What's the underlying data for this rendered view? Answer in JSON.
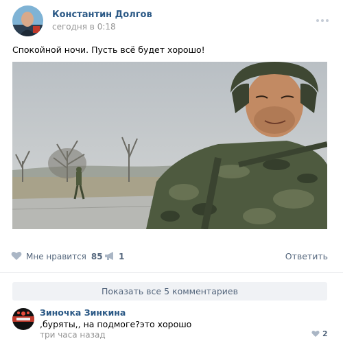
{
  "post": {
    "author": "Константин Долгов",
    "date": "сегодня в 0:18",
    "text": "Спокойной ночи. Пусть всё будет хорошо!",
    "actions": {
      "like_label": "Мне нравится",
      "like_count": "85",
      "share_count": "1",
      "reply_label": "Ответить"
    },
    "show_comments_label": "Показать все 5 комментариев"
  },
  "comment": {
    "author": "Зиночка Зинкина",
    "text": ",буряты,, на подмоге?это хорошо",
    "time": "три часа назад",
    "like_count": "2"
  },
  "icons": {
    "more": "more-dots-icon",
    "like": "heart-icon",
    "share": "megaphone-icon",
    "comment_like": "heart-icon"
  },
  "colors": {
    "link": "#2a5885",
    "muted": "#939393",
    "action": "#55677d",
    "button_bg": "#f0f2f5"
  }
}
